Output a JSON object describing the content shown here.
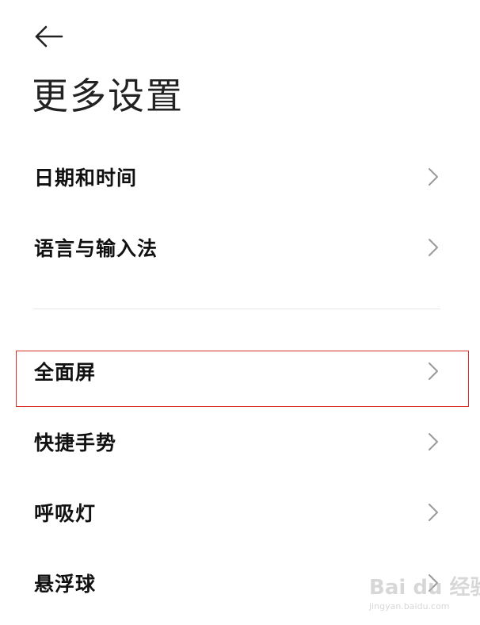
{
  "header": {
    "title": "更多设置"
  },
  "icons": {
    "back": "back-arrow-icon",
    "chevron": "chevron-right-icon"
  },
  "items": [
    {
      "label": "日期和时间"
    },
    {
      "label": "语言与输入法"
    },
    {
      "label": "全面屏",
      "highlighted": true
    },
    {
      "label": "快捷手势"
    },
    {
      "label": "呼吸灯"
    },
    {
      "label": "悬浮球"
    }
  ],
  "watermark": {
    "logo": "Bai du 经验",
    "url": "jingyan.baidu.com"
  },
  "colors": {
    "background": "#ffffff",
    "text": "#111111",
    "chevron": "#9a9a9a",
    "divider": "#e6e6e6",
    "highlight": "#d93025"
  }
}
